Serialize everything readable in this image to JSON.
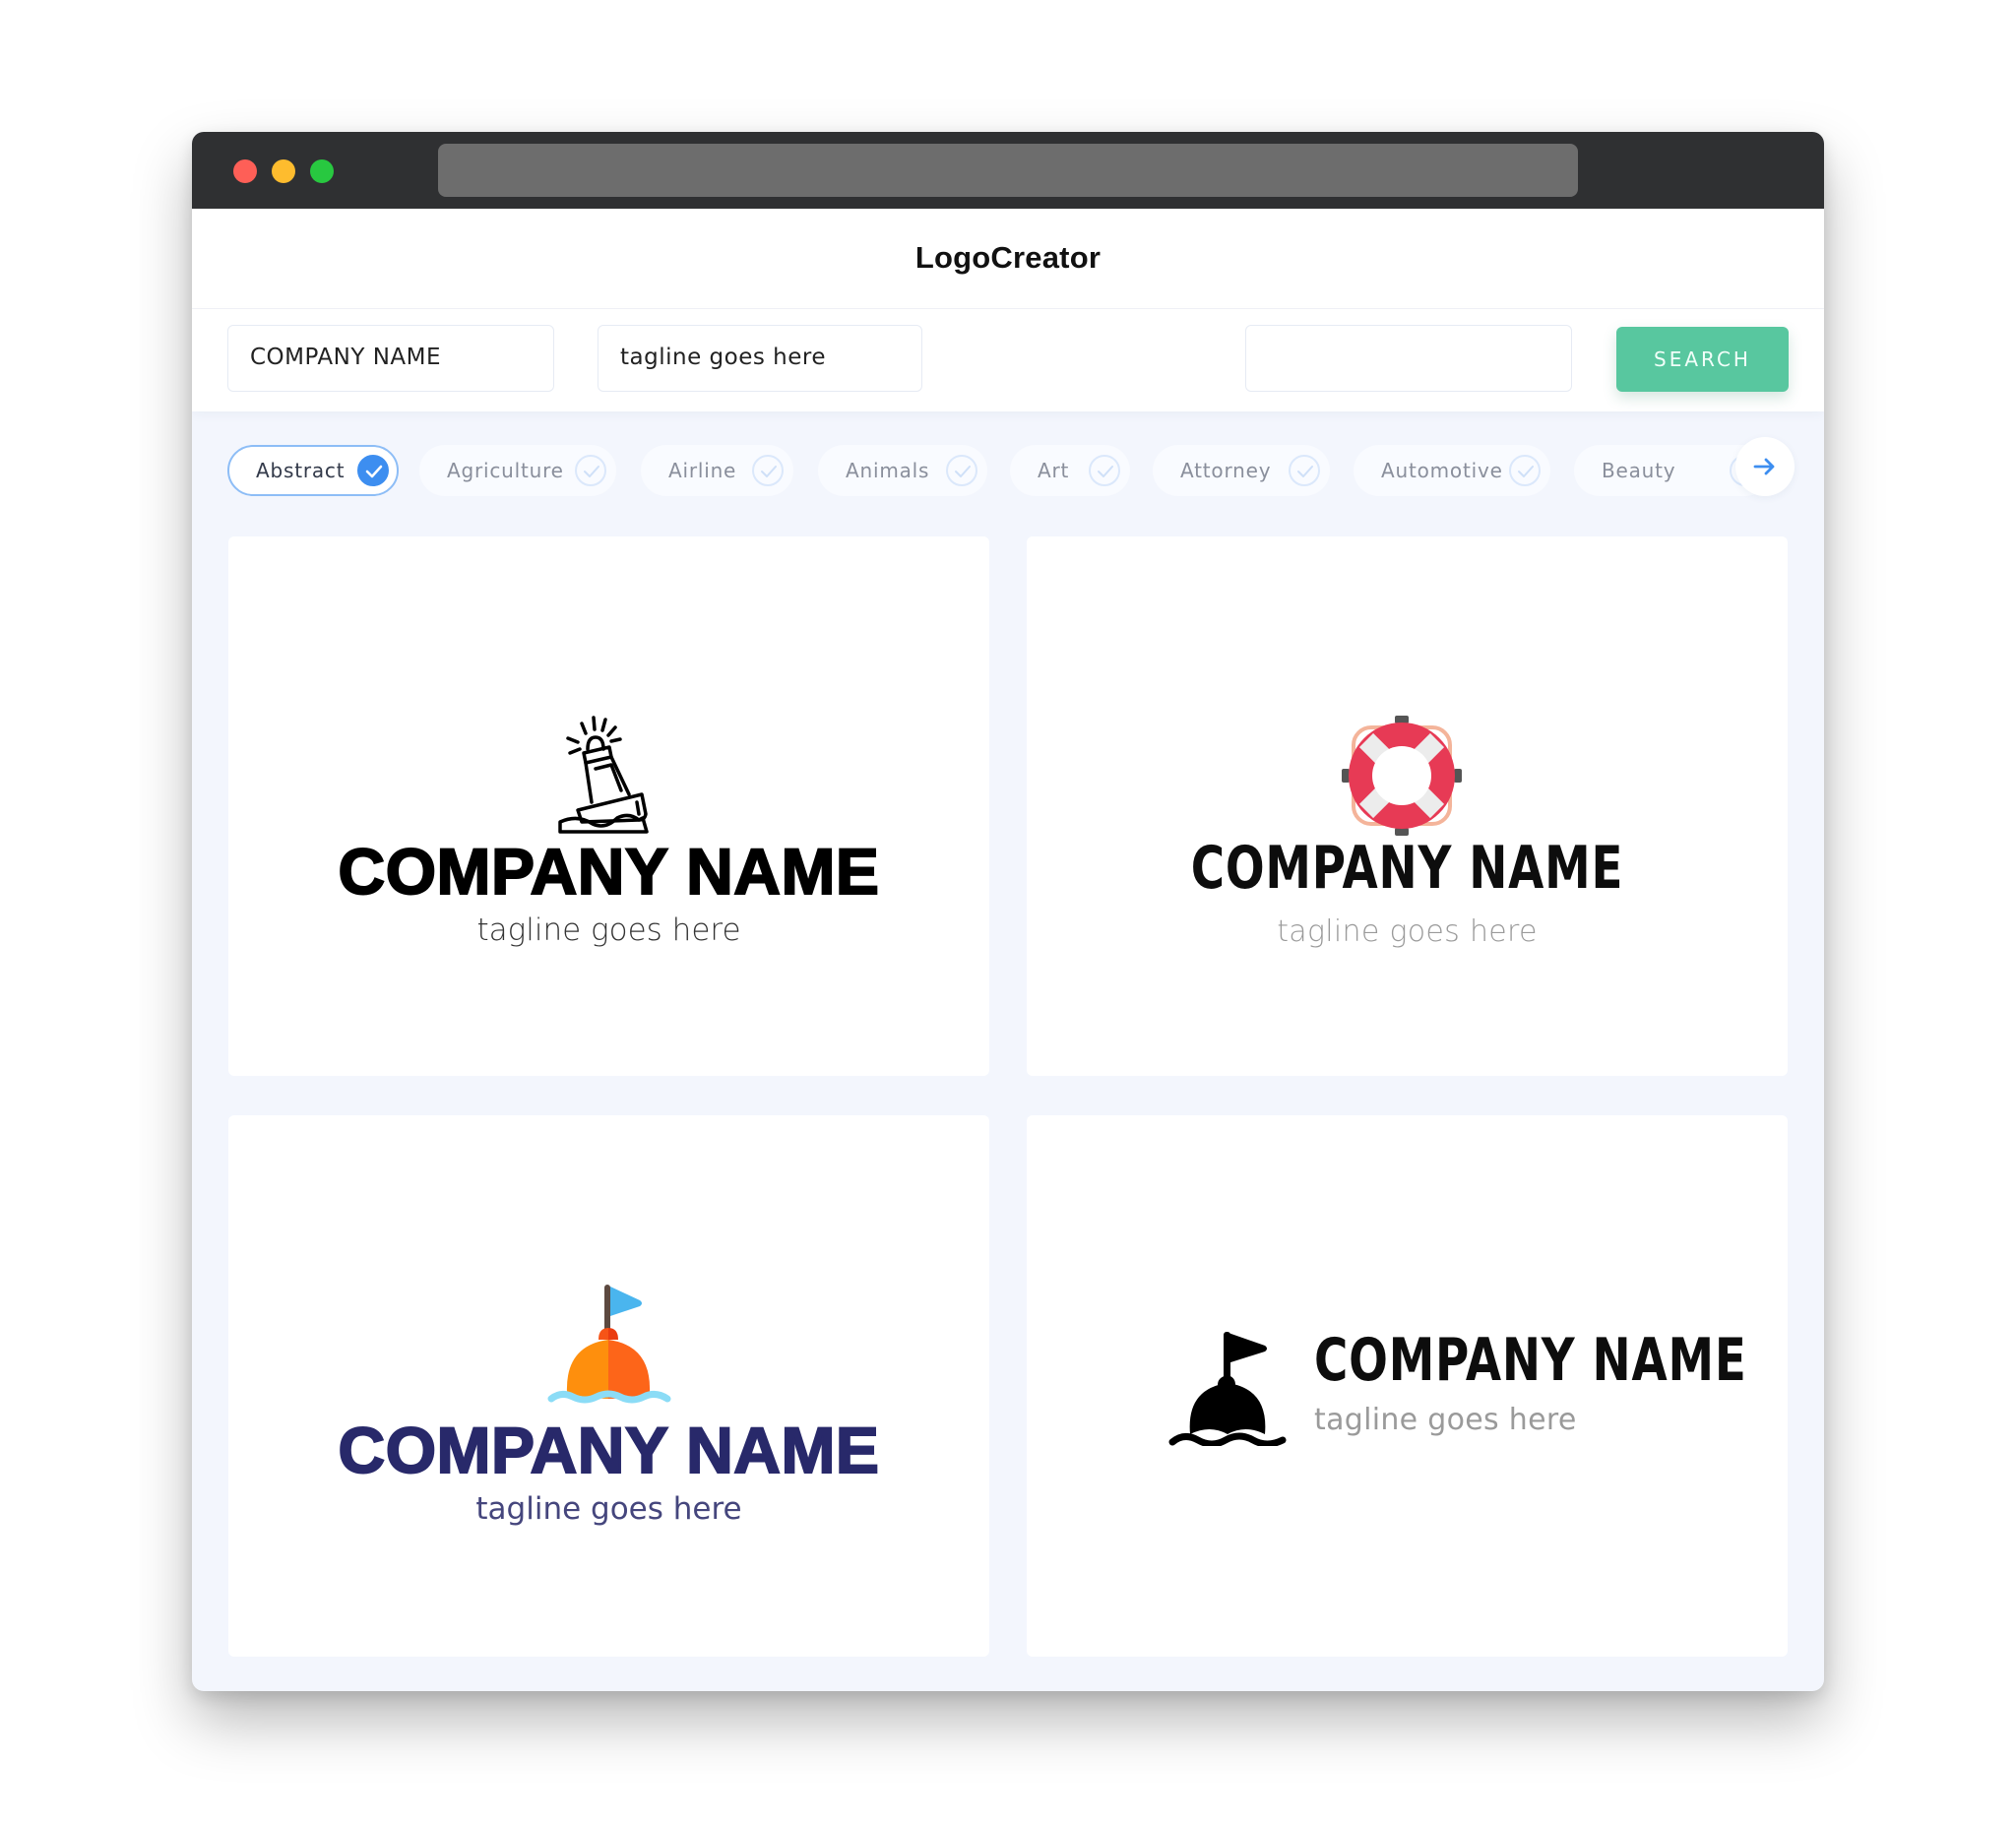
{
  "window": {
    "traffic_lights": [
      "close",
      "minimize",
      "maximize"
    ],
    "address_bar": ""
  },
  "header": {
    "brand": "LogoCreator"
  },
  "form": {
    "company_name": "COMPANY NAME",
    "tagline": "tagline goes here",
    "search_value": "",
    "search_button": "SEARCH"
  },
  "categories": [
    {
      "label": "Abstract",
      "selected": true
    },
    {
      "label": "Agriculture",
      "selected": false
    },
    {
      "label": "Airline",
      "selected": false
    },
    {
      "label": "Animals",
      "selected": false
    },
    {
      "label": "Art",
      "selected": false
    },
    {
      "label": "Attorney",
      "selected": false
    },
    {
      "label": "Automotive",
      "selected": false
    },
    {
      "label": "Beauty",
      "selected": false
    }
  ],
  "colors": {
    "accent": "#58c79f",
    "chip_selected": "#3d8ef0",
    "next_arrow": "#3d8ef0",
    "titlebar": "#2f3032",
    "page_bg": "#f3f6fd"
  },
  "logos": [
    {
      "icon": "lighthouse-buoy-outline-icon",
      "company": "COMPANY NAME",
      "tagline": "tagline goes here",
      "text_color": "#000000"
    },
    {
      "icon": "lifebuoy-icon",
      "company": "COMPANY NAME",
      "tagline": "tagline goes here",
      "text_color": "#0d0d0d"
    },
    {
      "icon": "buoy-flag-color-icon",
      "company": "COMPANY NAME",
      "tagline": "tagline goes here",
      "text_color": "#28296a"
    },
    {
      "icon": "buoy-flag-solid-icon",
      "company": "COMPANY NAME",
      "tagline": "tagline goes here",
      "text_color": "#0d0d0d"
    }
  ]
}
